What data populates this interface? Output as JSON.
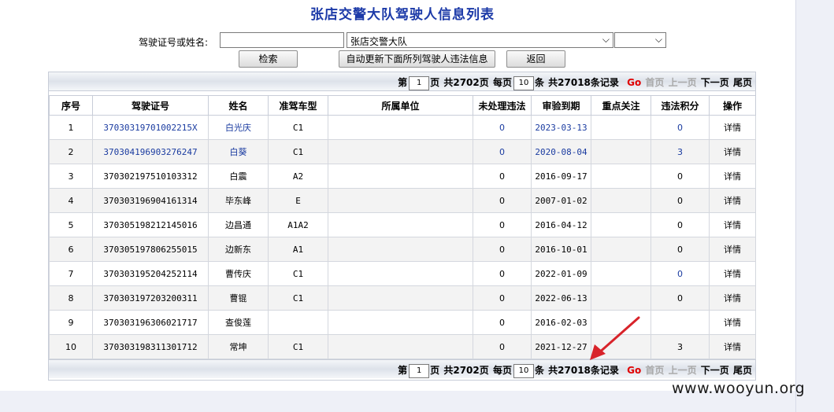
{
  "title": "张店交警大队驾驶人信息列表",
  "search": {
    "label": "驾驶证号或姓名:",
    "value": "",
    "dept_value": "张店交警大队",
    "sub_value": ""
  },
  "buttons": {
    "search": "检索",
    "update": "自动更新下面所列驾驶人违法信息",
    "back": "返回"
  },
  "pager": {
    "prefix": "第",
    "page": "1",
    "page_suffix": "页",
    "total_pages": "共2702页",
    "per_page_label": "每页",
    "per_page": "10",
    "per_page_suffix": "条",
    "total_records": "共27018条记录",
    "go": "Go",
    "first": "首页",
    "prev": "上一页",
    "next": "下一页",
    "last": "尾页"
  },
  "table": {
    "headers": [
      "序号",
      "驾驶证号",
      "姓名",
      "准驾车型",
      "所属单位",
      "未处理违法",
      "审验到期",
      "重点关注",
      "违法积分",
      "操作"
    ],
    "rows": [
      {
        "no": "1",
        "license": "37030319701002215X",
        "name": "白光庆",
        "class": "C1",
        "unit": "",
        "unhandled": "0",
        "due": "2023-03-13",
        "focus": "",
        "points": "0",
        "op": "详情"
      },
      {
        "no": "2",
        "license": "370304196903276247",
        "name": "白葵",
        "class": "C1",
        "unit": "",
        "unhandled": "0",
        "due": "2020-08-04",
        "focus": "",
        "points": "3",
        "op": "详情"
      },
      {
        "no": "3",
        "license": "370302197510103312",
        "name": "白震",
        "class": "A2",
        "unit": "",
        "unhandled": "0",
        "due": "2016-09-17",
        "focus": "",
        "points": "0",
        "op": "详情"
      },
      {
        "no": "4",
        "license": "370303196904161314",
        "name": "毕东峰",
        "class": "E",
        "unit": "",
        "unhandled": "0",
        "due": "2007-01-02",
        "focus": "",
        "points": "0",
        "op": "详情"
      },
      {
        "no": "5",
        "license": "370305198212145016",
        "name": "边昌通",
        "class": "A1A2",
        "unit": "",
        "unhandled": "0",
        "due": "2016-04-12",
        "focus": "",
        "points": "0",
        "op": "详情"
      },
      {
        "no": "6",
        "license": "370305197806255015",
        "name": "边新东",
        "class": "A1",
        "unit": "",
        "unhandled": "0",
        "due": "2016-10-01",
        "focus": "",
        "points": "0",
        "op": "详情"
      },
      {
        "no": "7",
        "license": "370303195204252114",
        "name": "曹传庆",
        "class": "C1",
        "unit": "",
        "unhandled": "0",
        "due": "2022-01-09",
        "focus": "",
        "points": "0",
        "op": "详情"
      },
      {
        "no": "8",
        "license": "370303197203200311",
        "name": "曹锟",
        "class": "C1",
        "unit": "",
        "unhandled": "0",
        "due": "2022-06-13",
        "focus": "",
        "points": "0",
        "op": "详情"
      },
      {
        "no": "9",
        "license": "370303196306021717",
        "name": "查俊莲",
        "class": "",
        "unit": "",
        "unhandled": "0",
        "due": "2016-02-03",
        "focus": "",
        "points": "",
        "op": "详情"
      },
      {
        "no": "10",
        "license": "370303198311301712",
        "name": "常坤",
        "class": "C1",
        "unit": "",
        "unhandled": "0",
        "due": "2021-12-27",
        "focus": "",
        "points": "3",
        "op": "详情"
      }
    ]
  },
  "watermark": "www.wooyun.org",
  "colors": {
    "title": "#1c3aa8",
    "link": "#1a3ba0",
    "go": "#e00000",
    "arrow": "#d8232a"
  }
}
